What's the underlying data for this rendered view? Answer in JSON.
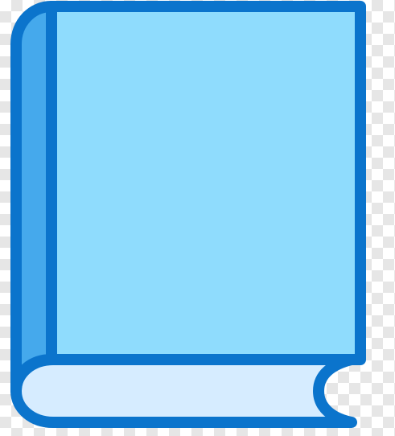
{
  "icon": {
    "name": "book-icon",
    "colors": {
      "outline": "#0b74cc",
      "cover": "#8fdcfd",
      "spine": "#45a9ec",
      "pages": "#d6ecff"
    }
  },
  "background": {
    "pattern": "checkerboard",
    "colors": [
      "#ffffff",
      "#e6e6e6"
    ]
  }
}
